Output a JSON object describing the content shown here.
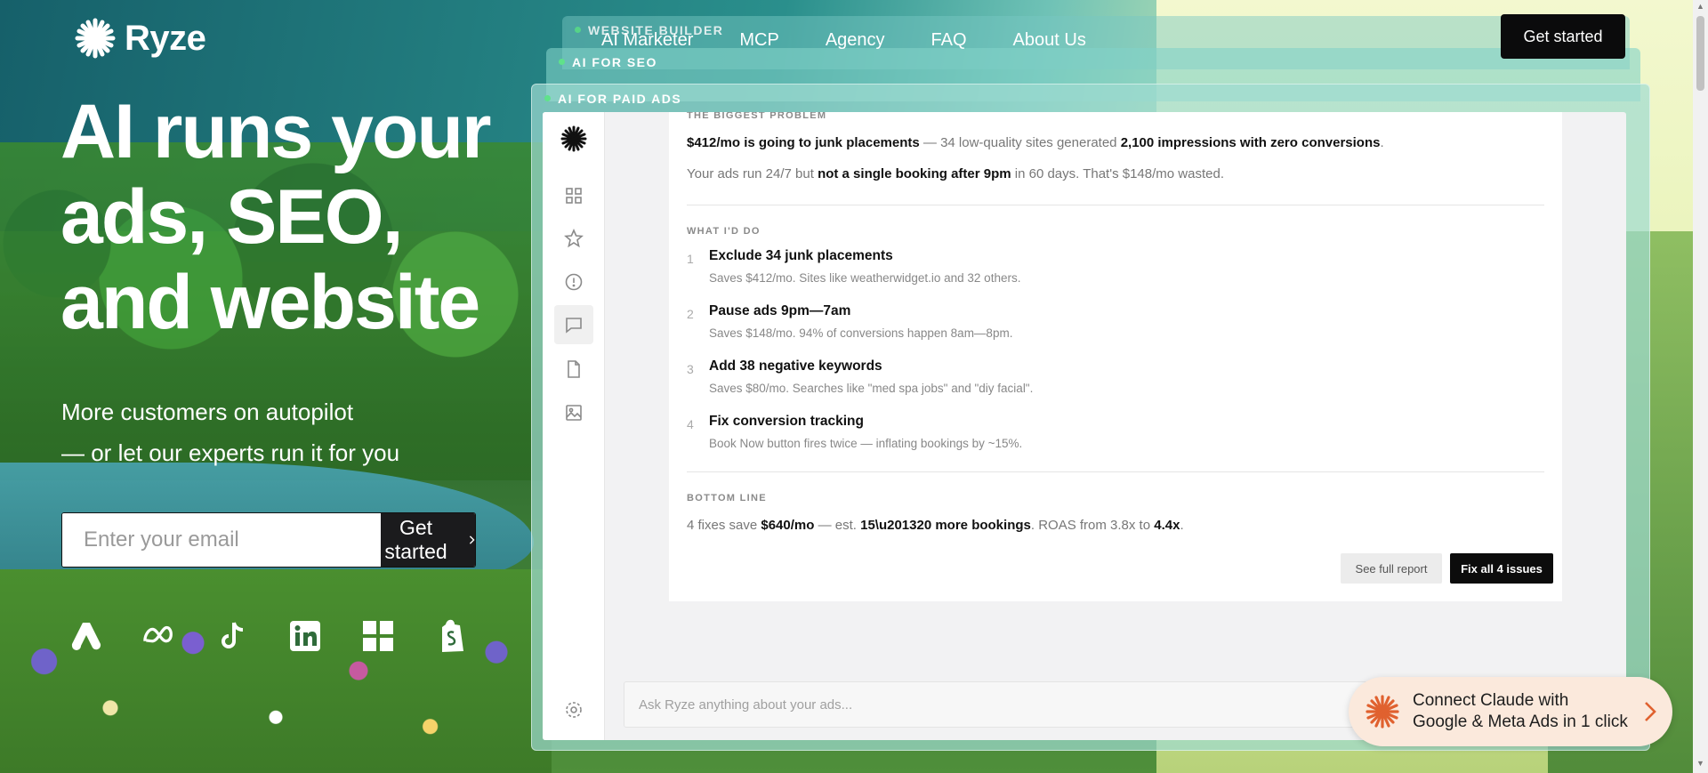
{
  "brand": {
    "name": "Ryze"
  },
  "nav": {
    "items": [
      "AI Marketer",
      "MCP",
      "Agency",
      "FAQ",
      "About Us"
    ]
  },
  "header": {
    "cta": "Get started"
  },
  "hero": {
    "title_lines": [
      "AI runs your",
      "ads, SEO,",
      "and website"
    ],
    "subtitle_lines": [
      "More customers on autopilot",
      "— or let our experts run it for you"
    ]
  },
  "signup": {
    "placeholder": "Enter your email",
    "button": "Get started"
  },
  "platform_icons": [
    "google-ads-icon",
    "meta-icon",
    "tiktok-icon",
    "linkedin-icon",
    "microsoft-icon",
    "shopify-icon"
  ],
  "cards": {
    "tabs": [
      "WEBSITE BUILDER",
      "AI FOR SEO",
      "AI FOR PAID ADS"
    ]
  },
  "sidebar_icons": [
    "ryze-logo-icon",
    "dashboard-icon",
    "star-icon",
    "alert-icon",
    "chat-icon",
    "document-icon",
    "image-icon",
    "settings-icon"
  ],
  "report": {
    "problem_label": "THE BIGGEST PROBLEM",
    "problem_line1": {
      "bold1": "$412/mo is going to junk placements",
      "mid": " — 34 low-quality sites generated ",
      "bold2": "2,100 impressions with zero conversions",
      "end": "."
    },
    "problem_line2": {
      "start": "Your ads run 24/7 but ",
      "bold": "not a single booking after 9pm",
      "end": " in 60 days. That's $148/mo wasted."
    },
    "actions_label": "WHAT I'D DO",
    "actions": [
      {
        "num": "1",
        "title": "Exclude 34 junk placements",
        "desc": "Saves $412/mo. Sites like weatherwidget.io and 32 others."
      },
      {
        "num": "2",
        "title": "Pause ads 9pm—7am",
        "desc": "Saves $148/mo. 94% of conversions happen 8am—8pm."
      },
      {
        "num": "3",
        "title": "Add 38 negative keywords",
        "desc": "Saves $80/mo. Searches like \"med spa jobs\" and \"diy facial\"."
      },
      {
        "num": "4",
        "title": "Fix conversion tracking",
        "desc": "Book Now button fires twice — inflating bookings by ~15%."
      }
    ],
    "bottom_label": "BOTTOM LINE",
    "bottom_line": {
      "start": "4 fixes save ",
      "bold1": "$640/mo",
      "mid": " — est. ",
      "bold2": "15\\u201320 more bookings",
      "mid2": ". ROAS from 3.8x to ",
      "bold3": "4.4x",
      "end": "."
    },
    "see_full": "See full report",
    "fix_all": "Fix all 4 issues"
  },
  "ask": {
    "placeholder": "Ask Ryze anything about your ads..."
  },
  "claude_banner": {
    "lines": [
      "Connect Claude with",
      "Google & Meta Ads in 1 click"
    ]
  }
}
